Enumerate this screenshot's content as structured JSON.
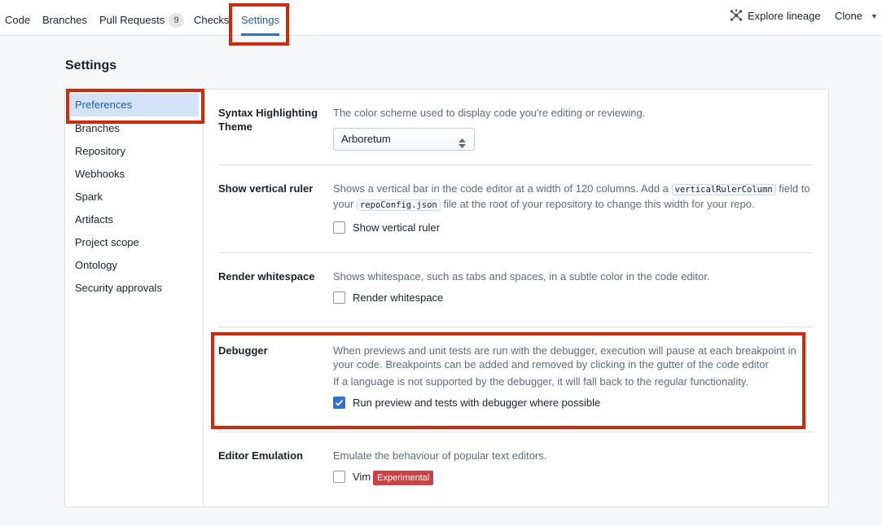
{
  "topbar": {
    "tabs": [
      {
        "label": "Code"
      },
      {
        "label": "Branches"
      },
      {
        "label": "Pull Requests",
        "badge": "9"
      },
      {
        "label": "Checks"
      },
      {
        "label": "Settings",
        "active": true
      }
    ],
    "explore_lineage": "Explore lineage",
    "clone": "Clone"
  },
  "page": {
    "title": "Settings"
  },
  "sidebar": {
    "items": [
      {
        "label": "Preferences",
        "active": true
      },
      {
        "label": "Branches"
      },
      {
        "label": "Repository"
      },
      {
        "label": "Webhooks"
      },
      {
        "label": "Spark"
      },
      {
        "label": "Artifacts"
      },
      {
        "label": "Project scope"
      },
      {
        "label": "Ontology"
      },
      {
        "label": "Security approvals"
      }
    ]
  },
  "sections": {
    "syntax": {
      "label": "Syntax Highlighting Theme",
      "description": "The color scheme used to display code you're editing or reviewing.",
      "selected": "Arboretum"
    },
    "ruler": {
      "label": "Show vertical ruler",
      "desc_part1": "Shows a vertical bar in the code editor at a width of 120 columns. Add a ",
      "code1": "verticalRulerColumn",
      "desc_part2": " field to your ",
      "code2": "repoConfig.json",
      "desc_part3": " file at the root of your repository to change this width for your repo.",
      "checkbox_label": "Show vertical ruler",
      "checked": false
    },
    "whitespace": {
      "label": "Render whitespace",
      "description": "Shows whitespace, such as tabs and spaces, in a subtle color in the code editor.",
      "checkbox_label": "Render whitespace",
      "checked": false
    },
    "debugger": {
      "label": "Debugger",
      "description": "When previews and unit tests are run with the debugger, execution will pause at each breakpoint in your code. Breakpoints can be added and removed by clicking in the gutter of the code editor",
      "description2": "If a language is not supported by the debugger, it will fall back to the regular functionality.",
      "checkbox_label": "Run preview and tests with debugger where possible",
      "checked": true
    },
    "emulation": {
      "label": "Editor Emulation",
      "description": "Emulate the behaviour of popular text editors.",
      "checkbox_label": "Vim",
      "tag": "Experimental",
      "checked": false
    }
  },
  "colors": {
    "accent": "#2d72d2",
    "annotation": "#d7260a",
    "experimental_tag": "#cd4246"
  }
}
